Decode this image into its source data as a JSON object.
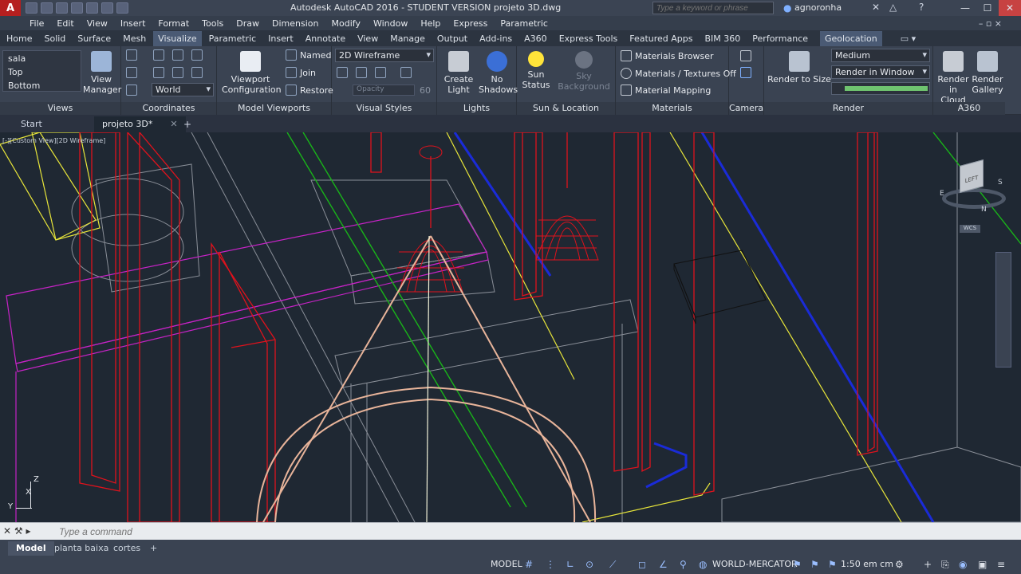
{
  "title": {
    "app_logo": "A",
    "window_title": "Autodesk AutoCAD 2016 - STUDENT VERSION    projeto 3D.dwg",
    "search_placeholder": "Type a keyword or phrase",
    "user": "agnoronha"
  },
  "menu": [
    "File",
    "Edit",
    "View",
    "Insert",
    "Format",
    "Tools",
    "Draw",
    "Dimension",
    "Modify",
    "Window",
    "Help",
    "Express",
    "Parametric"
  ],
  "ribbon_tabs": [
    "Home",
    "Solid",
    "Surface",
    "Mesh",
    "Visualize",
    "Parametric",
    "Insert",
    "Annotate",
    "View",
    "Manage",
    "Output",
    "Add-ins",
    "A360",
    "Express Tools",
    "Featured Apps",
    "BIM 360",
    "Performance",
    "Geolocation"
  ],
  "ribbon": {
    "views": {
      "items": [
        "sala",
        "Top",
        "Bottom"
      ],
      "view_manager": "View\nManager",
      "title": "Views"
    },
    "coordinates": {
      "ucs": "World",
      "title": "Coordinates"
    },
    "model_viewports": {
      "config": "Viewport\nConfiguration",
      "named": "Named",
      "join": "Join",
      "restore": "Restore",
      "title": "Model Viewports"
    },
    "visual_styles": {
      "style": "2D Wireframe",
      "opacity_label": "Opacity",
      "opacity_value": "60",
      "title": "Visual Styles"
    },
    "lights": {
      "create_light": "Create\nLight",
      "no_shadows": "No\nShadows",
      "title": "Lights"
    },
    "sun": {
      "sun_status": "Sun\nStatus",
      "sky_background": "Sky Background",
      "title": "Sun & Location"
    },
    "materials": {
      "browser": "Materials Browser",
      "textures": "Materials / Textures Off",
      "mapping": "Material Mapping",
      "title": "Materials"
    },
    "camera": {
      "title": "Camera"
    },
    "render": {
      "render_to_size": "Render to Size",
      "quality": "Medium",
      "render_in": "Render in Window",
      "title": "Render"
    },
    "a360": {
      "render_cloud": "Render in\nCloud",
      "render_gallery": "Render\nGallery",
      "title": "A360"
    }
  },
  "doc_tabs": [
    "Start",
    "projeto 3D*"
  ],
  "viewport_label": "[-][Custom View][2D Wireframe]",
  "viewcube": {
    "face": "LEFT",
    "compass": [
      "N",
      "S",
      "E"
    ],
    "wcs": "WCS"
  },
  "ucs_axes": {
    "x": "X",
    "y": "Y",
    "z": "Z"
  },
  "command_placeholder": "Type a command",
  "layout_tabs": [
    "Model",
    "planta baixa",
    "cortes"
  ],
  "status": {
    "space": "MODEL",
    "coord_system": "WORLD-MERCATOR",
    "scale": "1:50 em cm"
  },
  "colors": {
    "ribbon_bg": "#3a4352",
    "viewport_bg": "#1f2833",
    "red_lines": "#e0121c",
    "magenta_lines": "#c623c6",
    "green_lines": "#19b419",
    "blue_lines": "#1a2bd8",
    "yellow_lines": "#e8e63a"
  }
}
